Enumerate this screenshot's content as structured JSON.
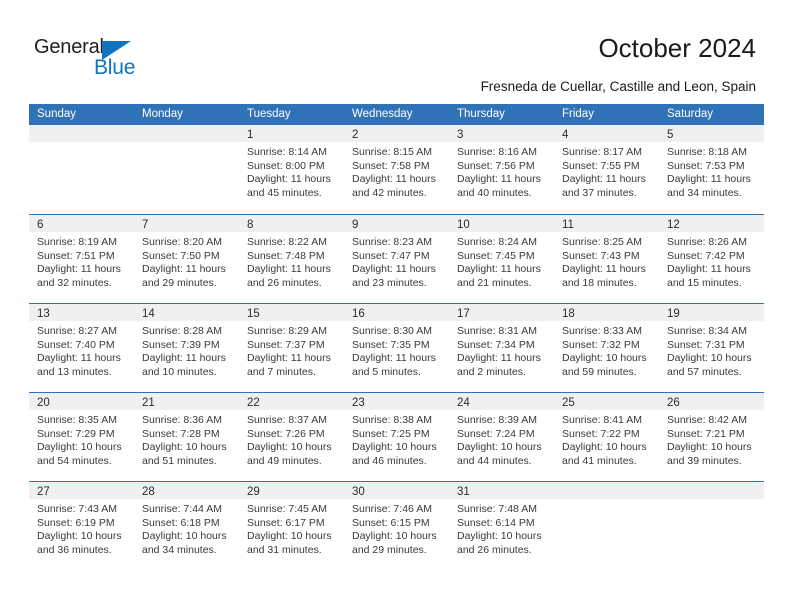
{
  "brand": {
    "name_top": "General",
    "name_bottom": "Blue",
    "accent_color": "#1274bc",
    "triangle_icon": "triangle-icon"
  },
  "header": {
    "title": "October 2024",
    "subtitle": "Fresneda de Cuellar, Castille and Leon, Spain"
  },
  "theme": {
    "header_blue": "#3072b8",
    "day_band_gray": "#f0f0f0",
    "text_color": "#3a3a3a"
  },
  "calendar": {
    "weekday_headers": [
      "Sunday",
      "Monday",
      "Tuesday",
      "Wednesday",
      "Thursday",
      "Friday",
      "Saturday"
    ],
    "weeks": [
      [
        {
          "day": "",
          "lines": []
        },
        {
          "day": "",
          "lines": []
        },
        {
          "day": "1",
          "lines": [
            "Sunrise: 8:14 AM",
            "Sunset: 8:00 PM",
            "Daylight: 11 hours",
            "and 45 minutes."
          ]
        },
        {
          "day": "2",
          "lines": [
            "Sunrise: 8:15 AM",
            "Sunset: 7:58 PM",
            "Daylight: 11 hours",
            "and 42 minutes."
          ]
        },
        {
          "day": "3",
          "lines": [
            "Sunrise: 8:16 AM",
            "Sunset: 7:56 PM",
            "Daylight: 11 hours",
            "and 40 minutes."
          ]
        },
        {
          "day": "4",
          "lines": [
            "Sunrise: 8:17 AM",
            "Sunset: 7:55 PM",
            "Daylight: 11 hours",
            "and 37 minutes."
          ]
        },
        {
          "day": "5",
          "lines": [
            "Sunrise: 8:18 AM",
            "Sunset: 7:53 PM",
            "Daylight: 11 hours",
            "and 34 minutes."
          ]
        }
      ],
      [
        {
          "day": "6",
          "lines": [
            "Sunrise: 8:19 AM",
            "Sunset: 7:51 PM",
            "Daylight: 11 hours",
            "and 32 minutes."
          ]
        },
        {
          "day": "7",
          "lines": [
            "Sunrise: 8:20 AM",
            "Sunset: 7:50 PM",
            "Daylight: 11 hours",
            "and 29 minutes."
          ]
        },
        {
          "day": "8",
          "lines": [
            "Sunrise: 8:22 AM",
            "Sunset: 7:48 PM",
            "Daylight: 11 hours",
            "and 26 minutes."
          ]
        },
        {
          "day": "9",
          "lines": [
            "Sunrise: 8:23 AM",
            "Sunset: 7:47 PM",
            "Daylight: 11 hours",
            "and 23 minutes."
          ]
        },
        {
          "day": "10",
          "lines": [
            "Sunrise: 8:24 AM",
            "Sunset: 7:45 PM",
            "Daylight: 11 hours",
            "and 21 minutes."
          ]
        },
        {
          "day": "11",
          "lines": [
            "Sunrise: 8:25 AM",
            "Sunset: 7:43 PM",
            "Daylight: 11 hours",
            "and 18 minutes."
          ]
        },
        {
          "day": "12",
          "lines": [
            "Sunrise: 8:26 AM",
            "Sunset: 7:42 PM",
            "Daylight: 11 hours",
            "and 15 minutes."
          ]
        }
      ],
      [
        {
          "day": "13",
          "lines": [
            "Sunrise: 8:27 AM",
            "Sunset: 7:40 PM",
            "Daylight: 11 hours",
            "and 13 minutes."
          ]
        },
        {
          "day": "14",
          "lines": [
            "Sunrise: 8:28 AM",
            "Sunset: 7:39 PM",
            "Daylight: 11 hours",
            "and 10 minutes."
          ]
        },
        {
          "day": "15",
          "lines": [
            "Sunrise: 8:29 AM",
            "Sunset: 7:37 PM",
            "Daylight: 11 hours",
            "and 7 minutes."
          ]
        },
        {
          "day": "16",
          "lines": [
            "Sunrise: 8:30 AM",
            "Sunset: 7:35 PM",
            "Daylight: 11 hours",
            "and 5 minutes."
          ]
        },
        {
          "day": "17",
          "lines": [
            "Sunrise: 8:31 AM",
            "Sunset: 7:34 PM",
            "Daylight: 11 hours",
            "and 2 minutes."
          ]
        },
        {
          "day": "18",
          "lines": [
            "Sunrise: 8:33 AM",
            "Sunset: 7:32 PM",
            "Daylight: 10 hours",
            "and 59 minutes."
          ]
        },
        {
          "day": "19",
          "lines": [
            "Sunrise: 8:34 AM",
            "Sunset: 7:31 PM",
            "Daylight: 10 hours",
            "and 57 minutes."
          ]
        }
      ],
      [
        {
          "day": "20",
          "lines": [
            "Sunrise: 8:35 AM",
            "Sunset: 7:29 PM",
            "Daylight: 10 hours",
            "and 54 minutes."
          ]
        },
        {
          "day": "21",
          "lines": [
            "Sunrise: 8:36 AM",
            "Sunset: 7:28 PM",
            "Daylight: 10 hours",
            "and 51 minutes."
          ]
        },
        {
          "day": "22",
          "lines": [
            "Sunrise: 8:37 AM",
            "Sunset: 7:26 PM",
            "Daylight: 10 hours",
            "and 49 minutes."
          ]
        },
        {
          "day": "23",
          "lines": [
            "Sunrise: 8:38 AM",
            "Sunset: 7:25 PM",
            "Daylight: 10 hours",
            "and 46 minutes."
          ]
        },
        {
          "day": "24",
          "lines": [
            "Sunrise: 8:39 AM",
            "Sunset: 7:24 PM",
            "Daylight: 10 hours",
            "and 44 minutes."
          ]
        },
        {
          "day": "25",
          "lines": [
            "Sunrise: 8:41 AM",
            "Sunset: 7:22 PM",
            "Daylight: 10 hours",
            "and 41 minutes."
          ]
        },
        {
          "day": "26",
          "lines": [
            "Sunrise: 8:42 AM",
            "Sunset: 7:21 PM",
            "Daylight: 10 hours",
            "and 39 minutes."
          ]
        }
      ],
      [
        {
          "day": "27",
          "lines": [
            "Sunrise: 7:43 AM",
            "Sunset: 6:19 PM",
            "Daylight: 10 hours",
            "and 36 minutes."
          ]
        },
        {
          "day": "28",
          "lines": [
            "Sunrise: 7:44 AM",
            "Sunset: 6:18 PM",
            "Daylight: 10 hours",
            "and 34 minutes."
          ]
        },
        {
          "day": "29",
          "lines": [
            "Sunrise: 7:45 AM",
            "Sunset: 6:17 PM",
            "Daylight: 10 hours",
            "and 31 minutes."
          ]
        },
        {
          "day": "30",
          "lines": [
            "Sunrise: 7:46 AM",
            "Sunset: 6:15 PM",
            "Daylight: 10 hours",
            "and 29 minutes."
          ]
        },
        {
          "day": "31",
          "lines": [
            "Sunrise: 7:48 AM",
            "Sunset: 6:14 PM",
            "Daylight: 10 hours",
            "and 26 minutes."
          ]
        },
        {
          "day": "",
          "lines": []
        },
        {
          "day": "",
          "lines": []
        }
      ]
    ]
  }
}
